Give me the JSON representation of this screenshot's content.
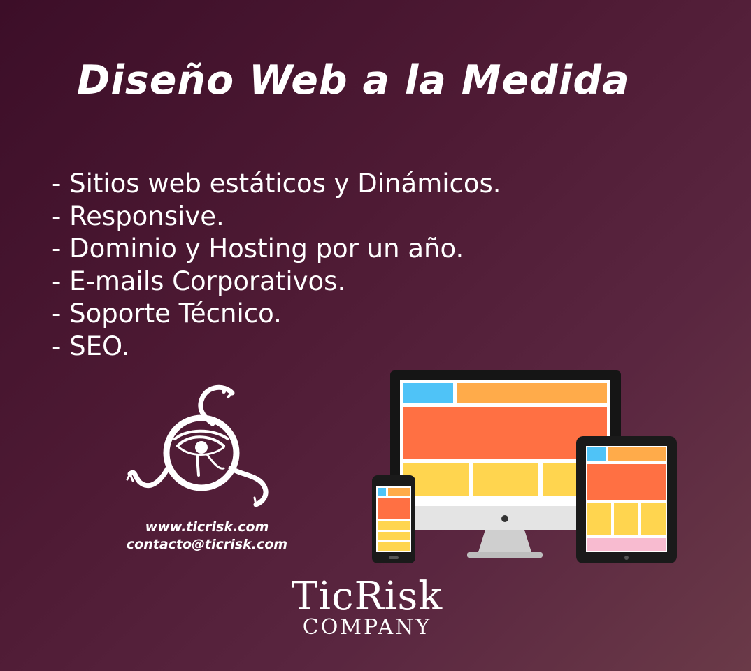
{
  "title": "Diseño Web a la Medida",
  "features": [
    "- Sitios web estáticos y Dinámicos.",
    "- Responsive.",
    "- Dominio y Hosting por un año.",
    "- E-mails Corporativos.",
    "- Soporte Técnico.",
    "- SEO."
  ],
  "contact": {
    "website": "www.ticrisk.com",
    "email": "contacto@ticrisk.com"
  },
  "brand": {
    "name": "TicRisk",
    "subtitle": "COMPANY"
  },
  "icons": {
    "logo": "serpent-eye-logo-icon",
    "devices": "responsive-devices-icon"
  },
  "colors": {
    "background": "#4e1a34",
    "text": "#ffffff",
    "mockup_blue": "#4fc3f7",
    "mockup_orange": "#ff7043",
    "mockup_light_orange": "#ffab4a",
    "mockup_yellow": "#ffd54f",
    "mockup_pink": "#f8bbd0"
  }
}
